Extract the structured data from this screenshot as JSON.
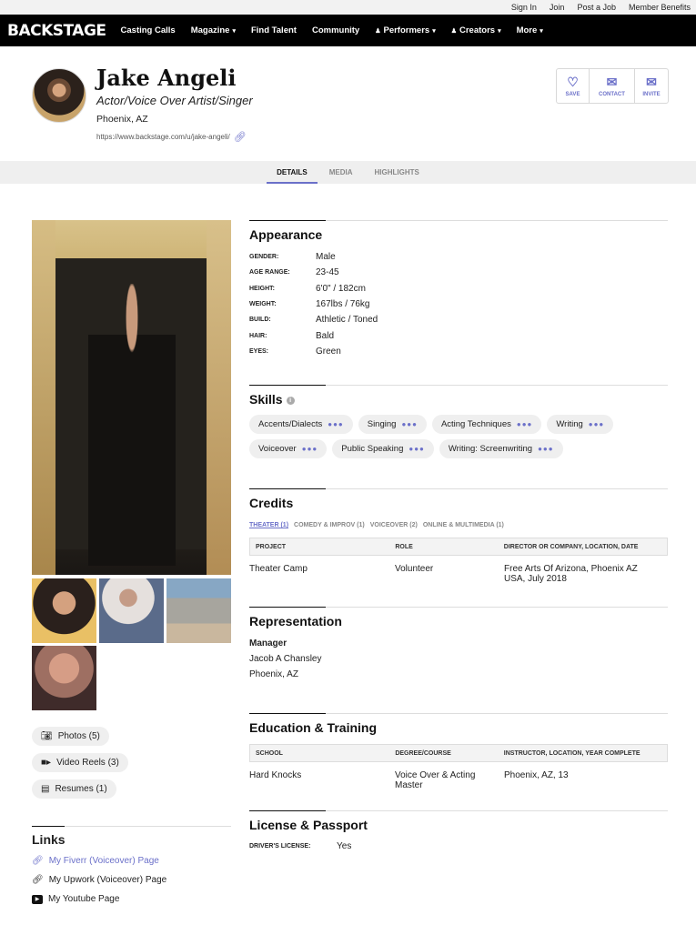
{
  "topbar": {
    "sign_in": "Sign In",
    "join": "Join",
    "post_job": "Post a Job",
    "member_benefits": "Member Benefits"
  },
  "nav": {
    "logo": "BACKSTAGE",
    "casting_calls": "Casting Calls",
    "magazine": "Magazine",
    "find_talent": "Find Talent",
    "community": "Community",
    "performers": "Performers",
    "creators": "Creators",
    "more": "More"
  },
  "profile": {
    "name": "Jake Angeli",
    "tagline": "Actor/Voice Over Artist/Singer",
    "location": "Phoenix, AZ",
    "url": "https://www.backstage.com/u/jake-angeli/",
    "actions": {
      "save": "SAVE",
      "contact": "CONTACT",
      "invite": "INVITE"
    }
  },
  "tabs": {
    "details": "DETAILS",
    "media": "MEDIA",
    "highlights": "HIGHLIGHTS"
  },
  "media": {
    "photos": "Photos (5)",
    "video_reels": "Video Reels (3)",
    "resumes": "Resumes (1)"
  },
  "links": {
    "title": "Links",
    "items": [
      {
        "label": "My Fiverr (Voiceover) Page"
      },
      {
        "label": "My Upwork (Voiceover) Page"
      },
      {
        "label": "My Youtube Page"
      }
    ]
  },
  "appearance": {
    "title": "Appearance",
    "rows": [
      {
        "k": "GENDER:",
        "v": "Male"
      },
      {
        "k": "AGE RANGE:",
        "v": "23-45"
      },
      {
        "k": "HEIGHT:",
        "v": "6'0\" / 182cm"
      },
      {
        "k": "WEIGHT:",
        "v": "167lbs / 76kg"
      },
      {
        "k": "BUILD:",
        "v": "Athletic / Toned"
      },
      {
        "k": "HAIR:",
        "v": "Bald"
      },
      {
        "k": "EYES:",
        "v": "Green"
      }
    ]
  },
  "skills": {
    "title": "Skills",
    "items": [
      "Accents/Dialects",
      "Singing",
      "Acting Techniques",
      "Writing",
      "Voiceover",
      "Public Speaking",
      "Writing: Screenwriting"
    ]
  },
  "credits": {
    "title": "Credits",
    "tabs": [
      "THEATER (1)",
      "COMEDY & IMPROV (1)",
      "VOICEOVER (2)",
      "ONLINE & MULTIMEDIA (1)"
    ],
    "headers": {
      "project": "PROJECT",
      "role": "ROLE",
      "director": "DIRECTOR OR COMPANY, LOCATION, DATE"
    },
    "row": {
      "project": "Theater Camp",
      "role": "Volunteer",
      "director_l1": "Free Arts Of Arizona, Phoenix AZ",
      "director_l2": "USA, July 2018"
    }
  },
  "representation": {
    "title": "Representation",
    "type": "Manager",
    "name": "Jacob A Chansley",
    "location": "Phoenix, AZ"
  },
  "education": {
    "title": "Education & Training",
    "headers": {
      "school": "SCHOOL",
      "degree": "DEGREE/COURSE",
      "instructor": "INSTRUCTOR, LOCATION, YEAR COMPLETE"
    },
    "row": {
      "school": "Hard Knocks",
      "degree_l1": "Voice Over & Acting",
      "degree_l2": "Master",
      "instructor": "Phoenix, AZ, 13"
    }
  },
  "license": {
    "title": "License & Passport",
    "k": "DRIVER'S LICENSE:",
    "v": "Yes"
  },
  "colors": {
    "accent": "#6b70c9",
    "nav_bg": "#000000"
  }
}
